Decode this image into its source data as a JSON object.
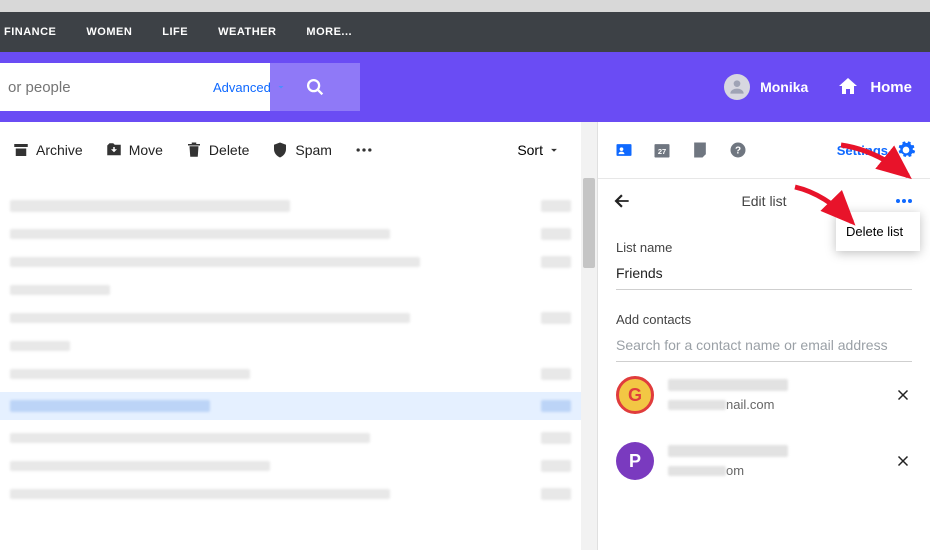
{
  "nav": {
    "items": [
      "FINANCE",
      "WOMEN",
      "LIFE",
      "WEATHER",
      "MORE..."
    ]
  },
  "search": {
    "placeholder": "or people",
    "advanced_label": "Advanced"
  },
  "user": {
    "name": "Monika"
  },
  "home": {
    "label": "Home"
  },
  "toolbar": {
    "archive": "Archive",
    "move": "Move",
    "delete": "Delete",
    "spam": "Spam",
    "sort": "Sort"
  },
  "sidepanel": {
    "settings_label": "Settings",
    "header_title": "Edit list",
    "list_name_label": "List name",
    "list_name_value": "Friends",
    "add_contacts_label": "Add contacts",
    "add_contacts_placeholder": "Search for a contact name or email address",
    "menu": {
      "delete_list": "Delete list"
    },
    "contacts": [
      {
        "avatar_letter": "G",
        "avatar_class": "g",
        "email_suffix": "nail.com"
      },
      {
        "avatar_letter": "P",
        "avatar_class": "p",
        "email_suffix": "om"
      }
    ]
  }
}
